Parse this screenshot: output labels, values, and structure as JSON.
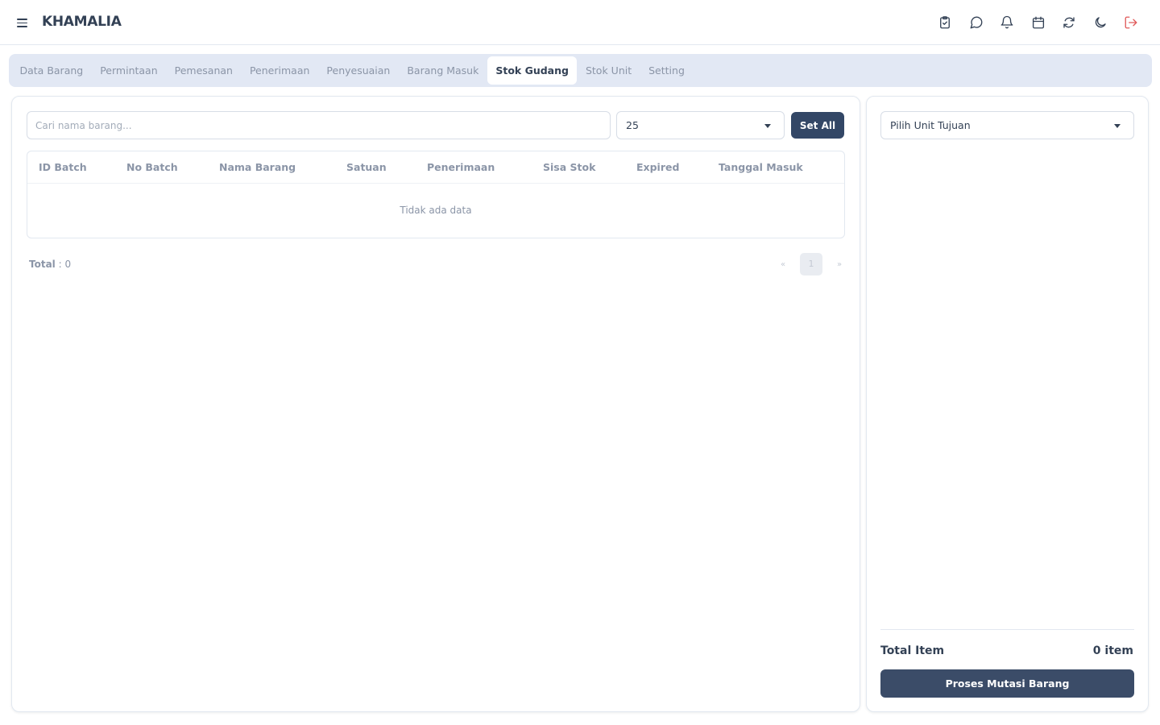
{
  "app": {
    "brand": "KHAMALIA"
  },
  "header": {
    "icons": [
      "clipboard-check-icon",
      "message-circle-icon",
      "bell-icon",
      "calendar-icon",
      "refresh-icon",
      "moon-icon",
      "logout-icon"
    ]
  },
  "tabs": [
    {
      "label": "Data Barang",
      "active": false
    },
    {
      "label": "Permintaan",
      "active": false
    },
    {
      "label": "Pemesanan",
      "active": false
    },
    {
      "label": "Penerimaan",
      "active": false
    },
    {
      "label": "Penyesuaian",
      "active": false
    },
    {
      "label": "Barang Masuk",
      "active": false
    },
    {
      "label": "Stok Gudang",
      "active": true
    },
    {
      "label": "Stok Unit",
      "active": false
    },
    {
      "label": "Setting",
      "active": false
    }
  ],
  "left_panel": {
    "search_placeholder": "Cari nama barang...",
    "page_size": "25",
    "set_all_label": "Set All",
    "columns": [
      "ID Batch",
      "No Batch",
      "Nama Barang",
      "Satuan",
      "Penerimaan",
      "Sisa Stok",
      "Expired",
      "Tanggal Masuk"
    ],
    "empty_text": "Tidak ada data",
    "total_label": "Total",
    "total_value": " : 0",
    "pagination": {
      "prev": "«",
      "current": "1",
      "next": "»"
    }
  },
  "right_panel": {
    "unit_placeholder": "Pilih Unit Tujuan",
    "total_item_label": "Total Item",
    "total_item_value": "0 item",
    "process_button": "Proses Mutasi Barang"
  },
  "colors": {
    "primary": "#334766",
    "logout": "#e05a5a",
    "tabbar_bg": "#e2e8f4"
  }
}
